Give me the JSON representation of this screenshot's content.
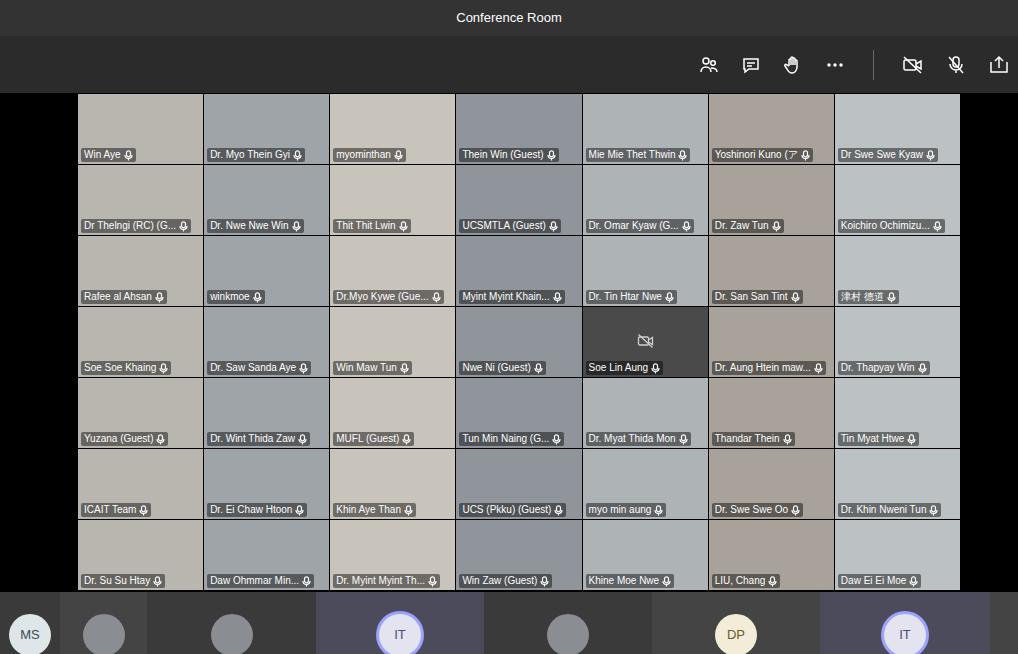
{
  "window": {
    "title": "Conference Room"
  },
  "participants": [
    {
      "name": "Win Aye",
      "kind": "video"
    },
    {
      "name": "Dr. Myo Thein Gyi",
      "kind": "video"
    },
    {
      "name": "myominthan",
      "kind": "video"
    },
    {
      "name": "Thein Win (Guest)",
      "kind": "video"
    },
    {
      "name": "Mie Mie Thet Thwin",
      "kind": "video"
    },
    {
      "name": "Yoshinori Kuno (ア",
      "kind": "video"
    },
    {
      "name": "Dr Swe Swe Kyaw",
      "kind": "video"
    },
    {
      "name": "Dr Thelngi (RC) (G...",
      "kind": "video"
    },
    {
      "name": "Dr. Nwe Nwe Win",
      "kind": "video"
    },
    {
      "name": "Thit Thit Lwin",
      "kind": "video"
    },
    {
      "name": "UCSMTLA (Guest)",
      "kind": "video"
    },
    {
      "name": "Dr. Omar Kyaw (G...",
      "kind": "video"
    },
    {
      "name": "Dr. Zaw Tun",
      "kind": "video"
    },
    {
      "name": "Koichiro Ochimizu...",
      "kind": "video"
    },
    {
      "name": "Rafee al Ahsan",
      "kind": "video"
    },
    {
      "name": "winkmoe",
      "kind": "video"
    },
    {
      "name": "Dr.Myo Kywe (Gue...",
      "kind": "video"
    },
    {
      "name": "Myint Myint Khain...",
      "kind": "video"
    },
    {
      "name": "Dr. Tin Htar Nwe",
      "kind": "video"
    },
    {
      "name": "Dr. San San Tint",
      "kind": "video"
    },
    {
      "name": "津村 德道",
      "kind": "video"
    },
    {
      "name": "Soe Soe Khaing",
      "kind": "video"
    },
    {
      "name": "Dr. Saw Sanda Aye",
      "kind": "video"
    },
    {
      "name": "Win Maw Tun",
      "kind": "video"
    },
    {
      "name": "Nwe Ni (Guest)",
      "kind": "video"
    },
    {
      "name": "Soe Lin Aung",
      "kind": "camera-off"
    },
    {
      "name": "Dr. Aung Htein maw...",
      "kind": "video"
    },
    {
      "name": "Dr. Thapyay Win",
      "kind": "video"
    },
    {
      "name": "Yuzana (Guest)",
      "kind": "video"
    },
    {
      "name": "Dr. Wint Thida Zaw",
      "kind": "video"
    },
    {
      "name": "MUFL (Guest)",
      "kind": "video"
    },
    {
      "name": "Tun Min Naing (G...",
      "kind": "video"
    },
    {
      "name": "Dr. Myat Thida Mon",
      "kind": "video"
    },
    {
      "name": "Thandar Thein",
      "kind": "video"
    },
    {
      "name": "Tin Myat Htwe",
      "kind": "video"
    },
    {
      "name": "ICAIT Team",
      "kind": "video"
    },
    {
      "name": "Dr. Ei Chaw Htoon",
      "kind": "video"
    },
    {
      "name": "Khin Aye Than",
      "kind": "video"
    },
    {
      "name": "UCS (Pkku) (Guest)",
      "kind": "video"
    },
    {
      "name": "myo min aung",
      "kind": "video"
    },
    {
      "name": "Dr. Swe Swe Oo",
      "kind": "video"
    },
    {
      "name": "Dr. Khin Nweni Tun",
      "kind": "video"
    },
    {
      "name": "Dr. Su Su Htay",
      "kind": "video"
    },
    {
      "name": "Daw Ohmmar Min...",
      "kind": "video"
    },
    {
      "name": "Dr. Myint Myint Th...",
      "kind": "video"
    },
    {
      "name": "Win Zaw (Guest)",
      "kind": "video"
    },
    {
      "name": "Khine Moe Nwe",
      "kind": "video"
    },
    {
      "name": "LIU, Chang",
      "kind": "video"
    },
    {
      "name": "Daw Ei Ei Moe",
      "kind": "video"
    }
  ],
  "roster": [
    {
      "kind": "initials",
      "initials": "MS",
      "speaking": false
    },
    {
      "kind": "photo",
      "speaking": false
    },
    {
      "kind": "photo",
      "speaking": false
    },
    {
      "kind": "initials",
      "initials": "IT",
      "speaking": true
    },
    {
      "kind": "photo",
      "speaking": false
    },
    {
      "kind": "initials",
      "initials": "DP",
      "speaking": false
    },
    {
      "kind": "initials",
      "initials": "IT",
      "speaking": true
    },
    {
      "kind": "empty",
      "speaking": false
    }
  ]
}
